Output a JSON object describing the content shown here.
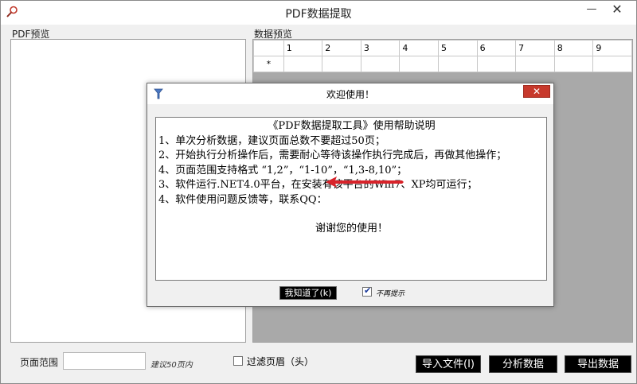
{
  "window": {
    "title": "PDF数据提取",
    "minimize_glyph": "—",
    "close_glyph": "✕"
  },
  "left_panel": {
    "label": "PDF预览"
  },
  "right_panel": {
    "label": "数据预览",
    "grid": {
      "columns": [
        "1",
        "2",
        "3",
        "4",
        "5",
        "6",
        "7",
        "8",
        "9"
      ],
      "rows": [
        {
          "header": "*"
        }
      ]
    }
  },
  "bottom": {
    "page_range_label": "页面范围",
    "page_range_value": "",
    "page_range_hint": "建议50页内",
    "filter_header_label": "过滤页眉（头）",
    "import_button": "导入文件(I)",
    "analyze_button": "分析数据",
    "export_button": "导出数据"
  },
  "dialog": {
    "title": "欢迎使用！",
    "close_glyph": "✕",
    "heading": "《PDF数据提取工具》使用帮助说明",
    "lines": [
      "1、单次分析数据，建议页面总数不要超过50页；",
      "2、开始执行分析操作后，需要耐心等待该操作执行完成后，再做其他操作；",
      "4、页面范围支持格式 “1,2”，“1-10”，“1,3-8,10”；",
      "3、软件运行.NET4.0平台，在安装有该平台的Win7、XP均可运行；",
      "4、软件使用问题反馈等，联系QQ："
    ],
    "thanks": "谢谢您的使用！",
    "ok_button": "我知道了(k)",
    "no_show_label": "不再提示",
    "no_show_checked": "✔"
  },
  "colors": {
    "titlebar": "#ffffff",
    "window_bg": "#f0f0f0",
    "grid_empty": "#a9a9a9",
    "button_bg": "#000000",
    "button_text": "#ffffff",
    "close_red": "#c7392c",
    "arrow_red": "#d8232a"
  },
  "icons": {
    "app": "magnifier-icon",
    "dialog": "app-small-icon",
    "checkmark": "check-icon"
  }
}
